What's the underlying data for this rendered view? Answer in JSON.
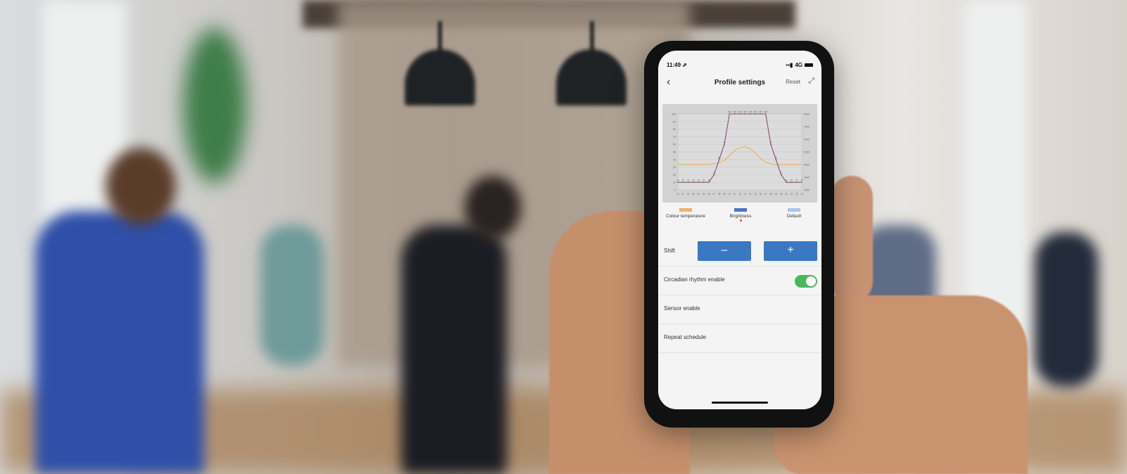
{
  "status": {
    "time": "11:49 ⇗",
    "network": "4G"
  },
  "nav": {
    "title": "Profile settings",
    "reset_label": "Reset",
    "back_icon": "chevron-left-icon",
    "expand_icon": "expand-icon"
  },
  "chart_data": {
    "type": "line",
    "title": "",
    "x": [
      0,
      1,
      2,
      3,
      4,
      5,
      6,
      7,
      8,
      9,
      10,
      11,
      12,
      13,
      14,
      15,
      16,
      17,
      18,
      19,
      20,
      21,
      22,
      23,
      24
    ],
    "xticklabels": [
      "00",
      "01",
      "02",
      "03",
      "04",
      "05",
      "06",
      "07",
      "08",
      "09",
      "10",
      "11",
      "12",
      "13",
      "14",
      "15",
      "16",
      "17",
      "18",
      "19",
      "20",
      "21",
      "22",
      "23",
      "24"
    ],
    "ylim_left": [
      0,
      100
    ],
    "ylim_right": [
      2000,
      8000
    ],
    "series": [
      {
        "name": "Colour temperature",
        "color": "#f0a850",
        "axis": "right",
        "values": [
          4000,
          4000,
          4000,
          4000,
          4000,
          4000,
          4000,
          4050,
          4150,
          4350,
          4700,
          5100,
          5350,
          5400,
          5250,
          4900,
          4500,
          4200,
          4050,
          4000,
          4000,
          4000,
          4000,
          4000,
          4000
        ]
      },
      {
        "name": "Brightness",
        "color": "#4a72c8",
        "axis": "left",
        "values": [
          10,
          10,
          10,
          10,
          10,
          10,
          10,
          20,
          40,
          60,
          100,
          100,
          100,
          100,
          100,
          100,
          100,
          100,
          60,
          40,
          20,
          10,
          10,
          10,
          10
        ]
      },
      {
        "name": "Default",
        "color": "#c0392b",
        "axis": "left",
        "values": [
          10,
          10,
          10,
          10,
          10,
          10,
          10,
          20,
          40,
          60,
          100,
          100,
          100,
          100,
          100,
          100,
          100,
          100,
          60,
          40,
          20,
          10,
          10,
          10,
          10
        ]
      }
    ]
  },
  "legend": [
    {
      "label": "Colour temperature",
      "color": "#f0b070"
    },
    {
      "label": "Brightness",
      "color": "#4a72c8"
    },
    {
      "label": "Default",
      "color": "#a9c4ee"
    }
  ],
  "settings": {
    "shift_label": "Shift",
    "minus_label": "–",
    "plus_label": "+",
    "circadian_label": "Circadian rhythm enable",
    "circadian_on": true,
    "sensor_label": "Sensor enable",
    "repeat_label": "Repeat schedule"
  }
}
